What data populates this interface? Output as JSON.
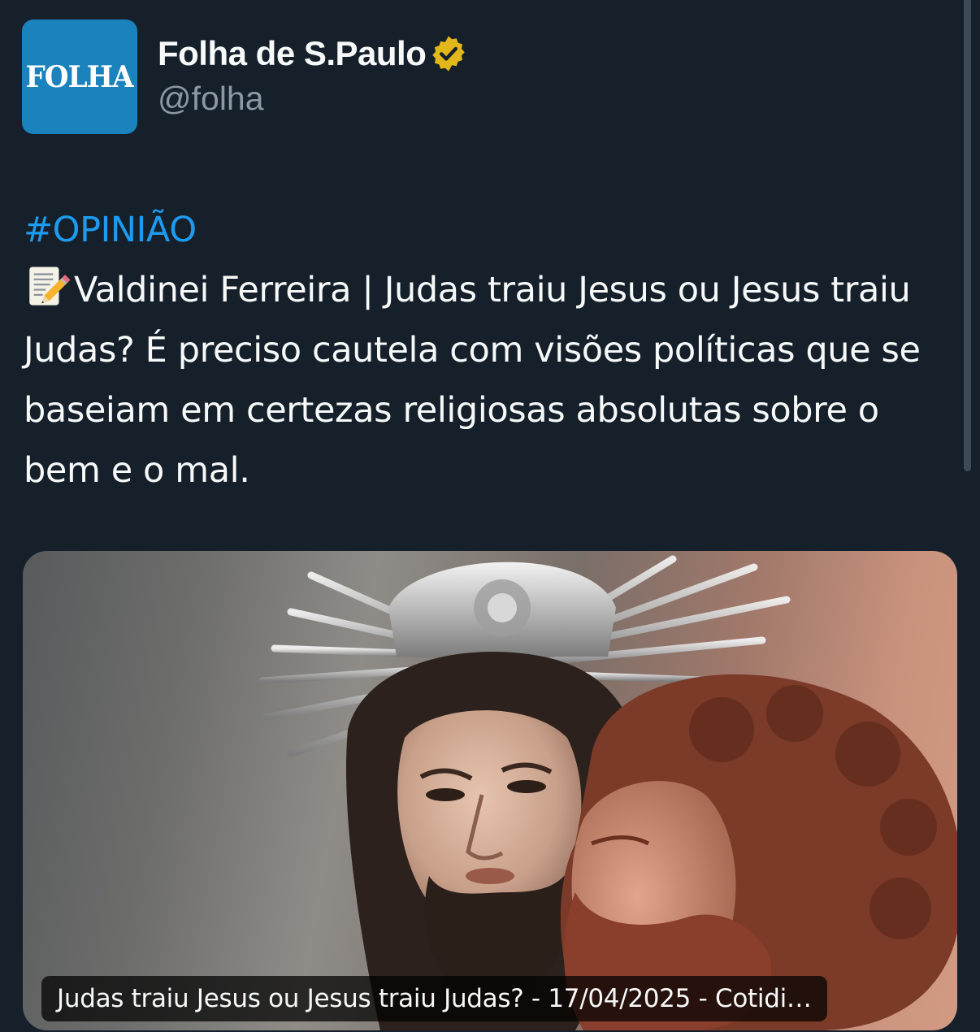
{
  "author": {
    "avatar_text": "FOLHA",
    "display_name": "Folha de S.Paulo",
    "handle": "@folha",
    "verified_icon": "verified-badge-icon",
    "verified_color": "#e2b719"
  },
  "tweet": {
    "hashtag": "#OPINIÃO",
    "emoji_icon": "memo-icon",
    "text": "Valdinei Ferreira | Judas traiu Jesus ou Jesus traiu Judas? É preciso cautela com visões políticas que se baseiam em certezas religiosas absolutas sobre o bem e o mal."
  },
  "media": {
    "caption": "Judas traiu Jesus ou Jesus traiu Judas? - 17/04/2025 - Cotidi…"
  },
  "colors": {
    "background": "#15202b",
    "hashtag": "#1d9bf0",
    "avatar_bg": "#1a83bd",
    "secondary_text": "#8b98a5"
  }
}
